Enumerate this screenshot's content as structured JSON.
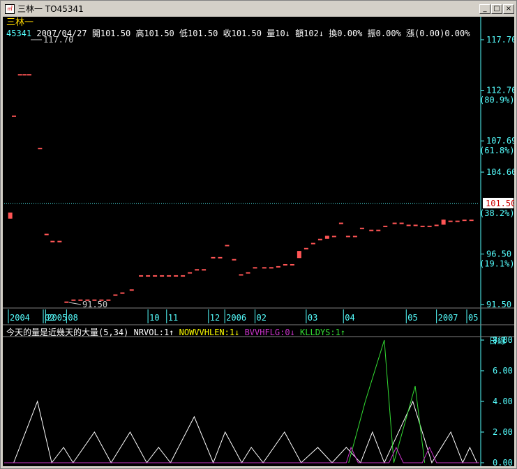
{
  "window": {
    "title": "三林一  TO45341",
    "minimize_glyph": "_",
    "maximize_glyph": "□",
    "close_glyph": "×"
  },
  "header": {
    "stock_name": "三林一",
    "code": "45341",
    "date": "2007/04/27",
    "open_label": "開101.50",
    "high_label": "高101.50",
    "low_label": "低101.50",
    "close_label": "收101.50",
    "volume_label": "量10↓",
    "amount_label": "額102↓",
    "turnover_label": "換0.00%",
    "amplitude_label": "振0.00%",
    "change_label": "漲(0.00)0.00%",
    "extra_label": "振"
  },
  "price_axis": {
    "ticks": [
      {
        "value": 117.7,
        "label": "117.70",
        "pct": ""
      },
      {
        "value": 112.7,
        "label": "112.70",
        "pct": "(80.9%)"
      },
      {
        "value": 107.69,
        "label": "107.69",
        "pct": "(61.8%)"
      },
      {
        "value": 104.6,
        "label": "104.60",
        "pct": ""
      },
      {
        "value": 96.5,
        "label": "96.50",
        "pct": "(19.1%)"
      },
      {
        "value": 91.5,
        "label": "91.50",
        "pct": ""
      }
    ],
    "current": {
      "label": "101.50",
      "pct": "(38.2%)",
      "value": 101.5
    },
    "high_marker": "117.70",
    "low_marker": "91.50",
    "colors": {
      "up": "#ff5555",
      "down": "#55ffff",
      "axis": "#55ffff",
      "current_bg": "#ffffff",
      "current_fg": "#cc0000"
    }
  },
  "date_axis": {
    "labels": [
      "2004",
      "02",
      "2005",
      "08",
      "10",
      "11",
      "12",
      "2006",
      "02",
      "03",
      "04",
      "05",
      "2007",
      "05"
    ],
    "scale_button": "日線"
  },
  "indicator": {
    "title": "今天的量是近幾天的大量(5,34)",
    "series_labels": [
      {
        "name": "NRVOL",
        "text": "NRVOL:1↑",
        "color": "#ffffff"
      },
      {
        "name": "NOWVVHLEN",
        "text": "NOWVVHLEN:1↓",
        "color": "#ffff00"
      },
      {
        "name": "BVVHFLG",
        "text": "BVVHFLG:0↓",
        "color": "#cc33cc"
      },
      {
        "name": "KLLDYS",
        "text": "KLLDYS:1↑",
        "color": "#33dd33"
      }
    ],
    "axis_ticks": [
      "8.00",
      "6.00",
      "4.00",
      "2.00",
      "0.00"
    ]
  },
  "chart_data": [
    {
      "type": "candlestick",
      "title": "三林一",
      "ylim": [
        91.5,
        117.7
      ],
      "bars": [
        [
          0.004,
          100.0,
          100.6,
          100.0,
          100.6
        ],
        [
          0.012,
          110.2,
          110.2,
          110.2,
          110.2
        ],
        [
          0.025,
          114.3,
          114.3,
          114.3,
          114.3
        ],
        [
          0.035,
          114.3,
          114.3,
          114.3,
          114.3
        ],
        [
          0.045,
          114.3,
          114.3,
          114.3,
          114.3
        ],
        [
          0.068,
          107.0,
          107.0,
          107.0,
          107.0
        ],
        [
          0.082,
          98.5,
          98.5,
          98.5,
          98.5
        ],
        [
          0.095,
          97.8,
          97.8,
          97.8,
          97.8
        ],
        [
          0.11,
          97.8,
          97.8,
          97.8,
          97.8
        ],
        [
          0.125,
          91.8,
          91.8,
          91.8,
          91.8
        ],
        [
          0.14,
          92.0,
          92.0,
          92.0,
          92.0
        ],
        [
          0.155,
          92.0,
          92.0,
          92.0,
          92.0
        ],
        [
          0.17,
          92.0,
          92.0,
          92.0,
          92.0
        ],
        [
          0.185,
          92.0,
          92.0,
          92.0,
          92.0
        ],
        [
          0.2,
          92.0,
          92.0,
          92.0,
          92.0
        ],
        [
          0.215,
          92.0,
          92.0,
          92.0,
          92.0
        ],
        [
          0.23,
          92.5,
          92.5,
          92.5,
          92.5
        ],
        [
          0.245,
          92.7,
          92.7,
          92.7,
          92.7
        ],
        [
          0.265,
          93.0,
          93.0,
          93.0,
          93.0
        ],
        [
          0.285,
          94.4,
          93.4,
          93.4,
          94.4
        ],
        [
          0.3,
          94.4,
          94.4,
          94.4,
          94.4
        ],
        [
          0.315,
          94.4,
          94.4,
          94.4,
          94.4
        ],
        [
          0.33,
          94.4,
          94.4,
          94.4,
          94.4
        ],
        [
          0.345,
          94.4,
          94.4,
          94.4,
          94.4
        ],
        [
          0.36,
          94.4,
          94.4,
          94.4,
          94.4
        ],
        [
          0.375,
          94.4,
          94.4,
          94.4,
          94.4
        ],
        [
          0.39,
          94.7,
          94.7,
          94.7,
          94.7
        ],
        [
          0.405,
          95.0,
          94.7,
          94.7,
          95.0
        ],
        [
          0.42,
          95.0,
          95.0,
          95.0,
          95.0
        ],
        [
          0.44,
          96.2,
          96.2,
          96.2,
          96.2
        ],
        [
          0.455,
          96.2,
          96.2,
          96.2,
          96.2
        ],
        [
          0.47,
          97.4,
          97.4,
          97.4,
          97.4
        ],
        [
          0.485,
          96.0,
          96.0,
          96.0,
          96.0
        ],
        [
          0.5,
          94.5,
          94.5,
          94.5,
          94.5
        ],
        [
          0.515,
          94.7,
          94.7,
          94.7,
          94.7
        ],
        [
          0.53,
          95.2,
          95.2,
          95.2,
          95.2
        ],
        [
          0.55,
          95.2,
          95.2,
          95.2,
          95.2
        ],
        [
          0.565,
          95.2,
          94.4,
          94.4,
          95.2
        ],
        [
          0.58,
          95.3,
          95.3,
          95.3,
          95.3
        ],
        [
          0.595,
          95.5,
          95.5,
          95.5,
          95.5
        ],
        [
          0.61,
          95.5,
          95.5,
          95.5,
          95.5
        ],
        [
          0.625,
          96.1,
          96.8,
          96.1,
          96.8
        ],
        [
          0.64,
          97.1,
          97.1,
          97.1,
          97.1
        ],
        [
          0.655,
          97.6,
          97.6,
          97.6,
          97.6
        ],
        [
          0.67,
          98.0,
          98.0,
          98.0,
          98.0
        ],
        [
          0.685,
          98.0,
          98.3,
          98.0,
          98.3
        ],
        [
          0.7,
          98.3,
          98.3,
          98.3,
          98.3
        ],
        [
          0.715,
          99.6,
          99.6,
          99.6,
          99.6
        ],
        [
          0.73,
          98.3,
          98.3,
          98.3,
          98.3
        ],
        [
          0.745,
          98.3,
          98.3,
          98.3,
          98.3
        ],
        [
          0.76,
          99.1,
          98.4,
          98.4,
          99.1
        ],
        [
          0.78,
          98.9,
          98.9,
          98.9,
          98.9
        ],
        [
          0.795,
          98.9,
          98.9,
          98.9,
          98.9
        ],
        [
          0.81,
          99.3,
          99.3,
          99.3,
          99.3
        ],
        [
          0.83,
          99.6,
          99.6,
          99.6,
          99.6
        ],
        [
          0.845,
          99.6,
          99.6,
          99.6,
          99.6
        ],
        [
          0.86,
          99.4,
          99.4,
          99.4,
          99.4
        ],
        [
          0.875,
          99.4,
          99.4,
          99.4,
          99.4
        ],
        [
          0.89,
          99.3,
          99.3,
          99.3,
          99.3
        ],
        [
          0.905,
          99.3,
          99.3,
          99.3,
          99.3
        ],
        [
          0.92,
          99.4,
          99.4,
          99.4,
          99.4
        ],
        [
          0.935,
          99.4,
          99.9,
          99.4,
          99.9
        ],
        [
          0.95,
          99.8,
          99.8,
          99.8,
          99.8
        ],
        [
          0.965,
          99.8,
          99.8,
          99.8,
          99.8
        ],
        [
          0.98,
          99.9,
          99.9,
          99.9,
          99.9
        ],
        [
          0.995,
          99.9,
          99.9,
          99.9,
          99.9
        ]
      ]
    },
    {
      "type": "line",
      "title": "今天的量是近幾天的大量(5,34)",
      "ylim": [
        0,
        8
      ],
      "series": [
        {
          "name": "NRVOL",
          "color": "#ffffff",
          "points": [
            [
              0.02,
              0
            ],
            [
              0.07,
              4
            ],
            [
              0.1,
              0
            ],
            [
              0.125,
              1
            ],
            [
              0.145,
              0
            ],
            [
              0.19,
              2
            ],
            [
              0.225,
              0
            ],
            [
              0.265,
              2
            ],
            [
              0.3,
              0
            ],
            [
              0.325,
              1
            ],
            [
              0.35,
              0
            ],
            [
              0.4,
              3
            ],
            [
              0.44,
              0
            ],
            [
              0.465,
              2
            ],
            [
              0.5,
              0
            ],
            [
              0.52,
              1
            ],
            [
              0.545,
              0
            ],
            [
              0.59,
              2
            ],
            [
              0.625,
              0
            ],
            [
              0.66,
              1
            ],
            [
              0.69,
              0
            ],
            [
              0.72,
              1
            ],
            [
              0.75,
              0
            ],
            [
              0.775,
              2
            ],
            [
              0.8,
              0
            ],
            [
              0.86,
              4
            ],
            [
              0.9,
              0
            ],
            [
              0.94,
              2
            ],
            [
              0.965,
              0
            ],
            [
              0.98,
              1
            ],
            [
              0.995,
              0
            ]
          ]
        },
        {
          "name": "KLLDYS",
          "color": "#33dd33",
          "points": [
            [
              0.725,
              0
            ],
            [
              0.76,
              4
            ],
            [
              0.8,
              8
            ],
            [
              0.82,
              0
            ],
            [
              0.865,
              5
            ],
            [
              0.885,
              0
            ]
          ]
        },
        {
          "name": "BVVHFLG",
          "color": "#cc33cc",
          "points": [
            [
              0.0,
              0
            ],
            [
              0.72,
              0
            ],
            [
              0.73,
              1
            ],
            [
              0.745,
              0
            ],
            [
              0.81,
              0
            ],
            [
              0.825,
              1
            ],
            [
              0.84,
              0
            ],
            [
              0.88,
              0
            ],
            [
              0.895,
              1
            ],
            [
              0.91,
              0
            ],
            [
              1.0,
              0
            ]
          ]
        }
      ]
    }
  ]
}
